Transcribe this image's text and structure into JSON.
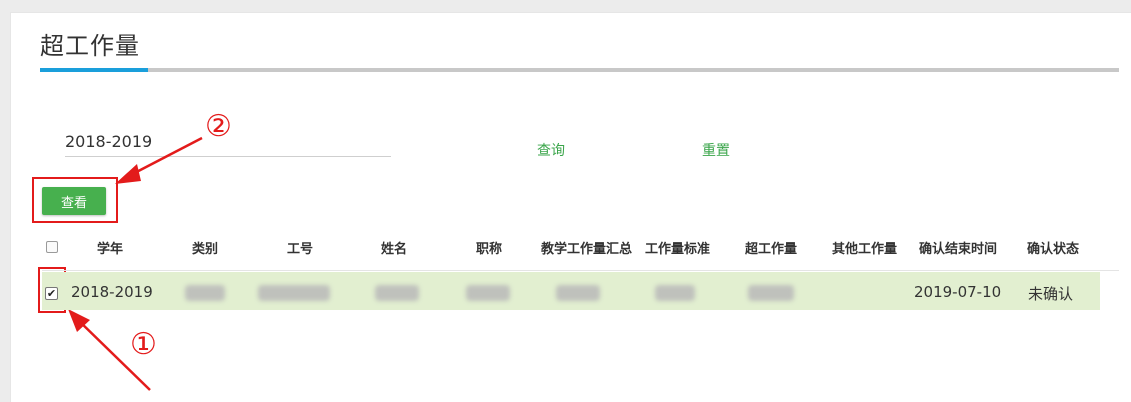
{
  "page": {
    "title": "超工作量"
  },
  "filter": {
    "year_value": "2018-2019",
    "query_label": "查询",
    "reset_label": "重置"
  },
  "actions": {
    "view_label": "查看"
  },
  "annotations": {
    "step1": "①",
    "step2": "②",
    "color": "#e31b1b"
  },
  "table": {
    "columns": [
      "学年",
      "类别",
      "工号",
      "姓名",
      "职称",
      "教学工作量汇总",
      "工作量标准",
      "超工作量",
      "其他工作量",
      "确认结束时间",
      "确认状态"
    ],
    "rows": [
      {
        "checked": true,
        "school_year": "2018-2019",
        "end_time": "2019-07-10",
        "status": "未确认"
      }
    ]
  },
  "colors": {
    "accent": "#1a9fdb",
    "primary_button": "#47b04e",
    "link": "#3aa54a",
    "row_selected": "#e2efd0"
  }
}
